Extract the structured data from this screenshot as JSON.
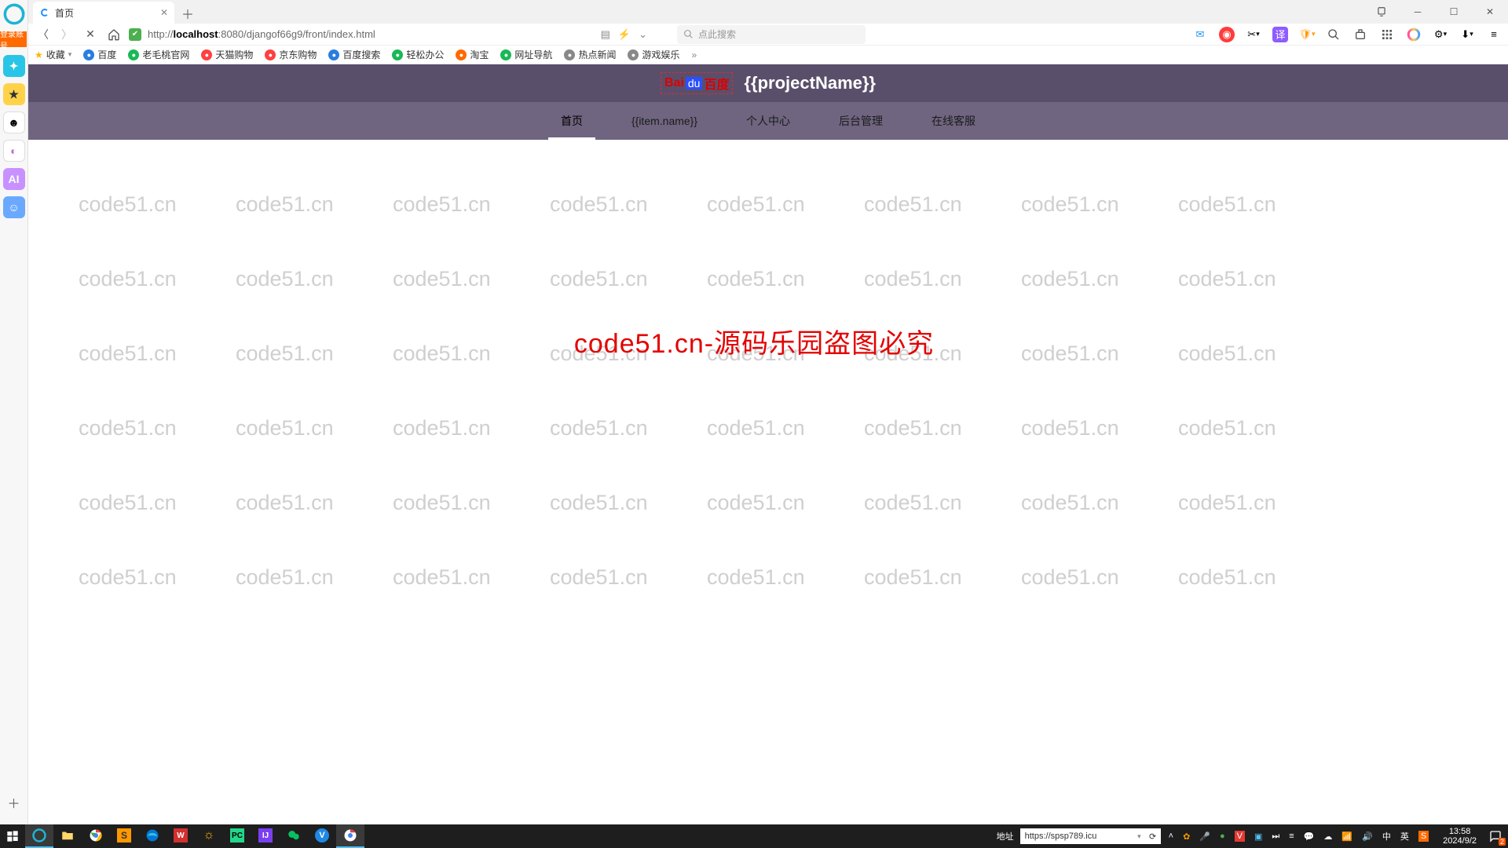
{
  "browser": {
    "login_tag": "登录账号",
    "tab_title": "首页",
    "url_display_prefix": "http://",
    "url_host": "localhost",
    "url_rest": ":8080/djangof66g9/front/index.html",
    "search_placeholder": "点此搜索"
  },
  "bookmarks": {
    "fav": "收藏",
    "items": [
      "百度",
      "老毛桃官网",
      "天猫购物",
      "京东购物",
      "百度搜索",
      "轻松办公",
      "淘宝",
      "网址导航",
      "热点新闻",
      "游戏娱乐"
    ]
  },
  "header": {
    "baidu_b1": "Bai",
    "baidu_b2": "du",
    "baidu_b3": "百度",
    "project": "{{projectName}}"
  },
  "nav": {
    "items": [
      "首页",
      "{{item.name}}",
      "个人中心",
      "后台管理",
      "在线客服"
    ],
    "active": 0
  },
  "watermark": {
    "cell": "code51.cn",
    "center": "code51.cn-源码乐园盗图必究"
  },
  "taskbar": {
    "addr_label": "地址",
    "addr_value": "https://spsp789.icu",
    "ime1": "中",
    "ime2": "英",
    "time": "13:58",
    "date": "2024/9/2",
    "notif_badge": "2"
  }
}
